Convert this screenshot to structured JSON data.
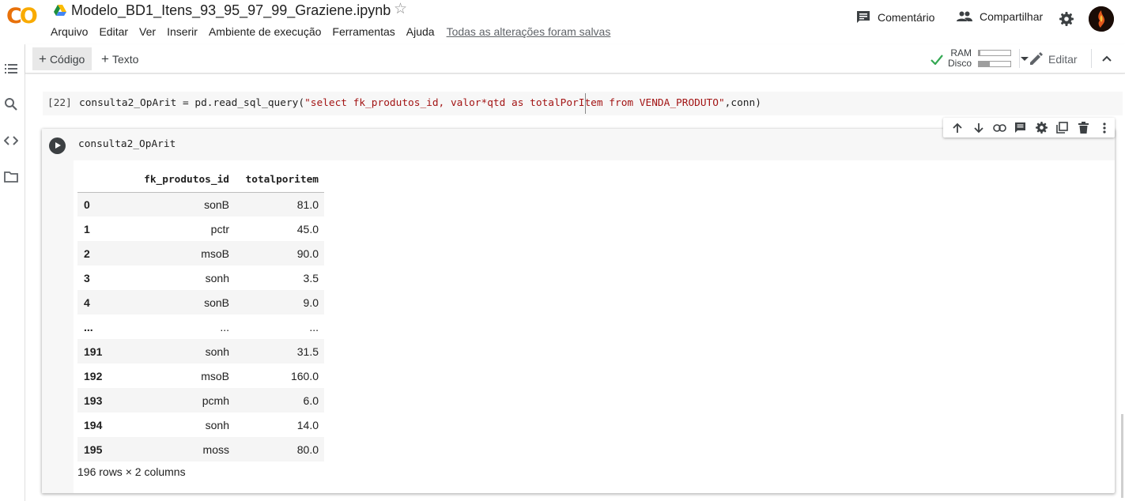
{
  "app": {
    "logo_text": "CO",
    "notebook_title": "Modelo_BD1_Itens_93_95_97_99_Graziene.ipynb",
    "save_status": "Todas as alterações foram salvas"
  },
  "menu": [
    "Arquivo",
    "Editar",
    "Ver",
    "Inserir",
    "Ambiente de execução",
    "Ferramentas",
    "Ajuda"
  ],
  "header": {
    "comment_label": "Comentário",
    "share_label": "Compartilhar"
  },
  "toolbar": {
    "add_code_label": "Código",
    "add_text_label": "Texto",
    "ram_label": "RAM",
    "disk_label": "Disco",
    "ram_usage": 0.05,
    "disk_usage": 0.35,
    "edit_label": "Editar"
  },
  "cells": {
    "cell1": {
      "prompt": "[22]",
      "code_pre": "consulta2_OpArit = pd.read_sql_query(",
      "code_str": "\"select fk_produtos_id, valor*qtd as totalPorItem from VENDA_PRODUTO\"",
      "code_post": ",conn)"
    },
    "cell2": {
      "code": "consulta2_OpArit"
    }
  },
  "dataframe": {
    "columns": [
      "fk_produtos_id",
      "totalporitem"
    ],
    "rows": [
      {
        "index": "0",
        "fk_produtos_id": "sonB",
        "totalporitem": "81.0"
      },
      {
        "index": "1",
        "fk_produtos_id": "pctr",
        "totalporitem": "45.0"
      },
      {
        "index": "2",
        "fk_produtos_id": "msoB",
        "totalporitem": "90.0"
      },
      {
        "index": "3",
        "fk_produtos_id": "sonh",
        "totalporitem": "3.5"
      },
      {
        "index": "4",
        "fk_produtos_id": "sonB",
        "totalporitem": "9.0"
      },
      {
        "index": "...",
        "fk_produtos_id": "...",
        "totalporitem": "..."
      },
      {
        "index": "191",
        "fk_produtos_id": "sonh",
        "totalporitem": "31.5"
      },
      {
        "index": "192",
        "fk_produtos_id": "msoB",
        "totalporitem": "160.0"
      },
      {
        "index": "193",
        "fk_produtos_id": "pcmh",
        "totalporitem": "6.0"
      },
      {
        "index": "194",
        "fk_produtos_id": "sonh",
        "totalporitem": "14.0"
      },
      {
        "index": "195",
        "fk_produtos_id": "moss",
        "totalporitem": "80.0"
      }
    ],
    "footer": "196 rows × 2 columns"
  }
}
